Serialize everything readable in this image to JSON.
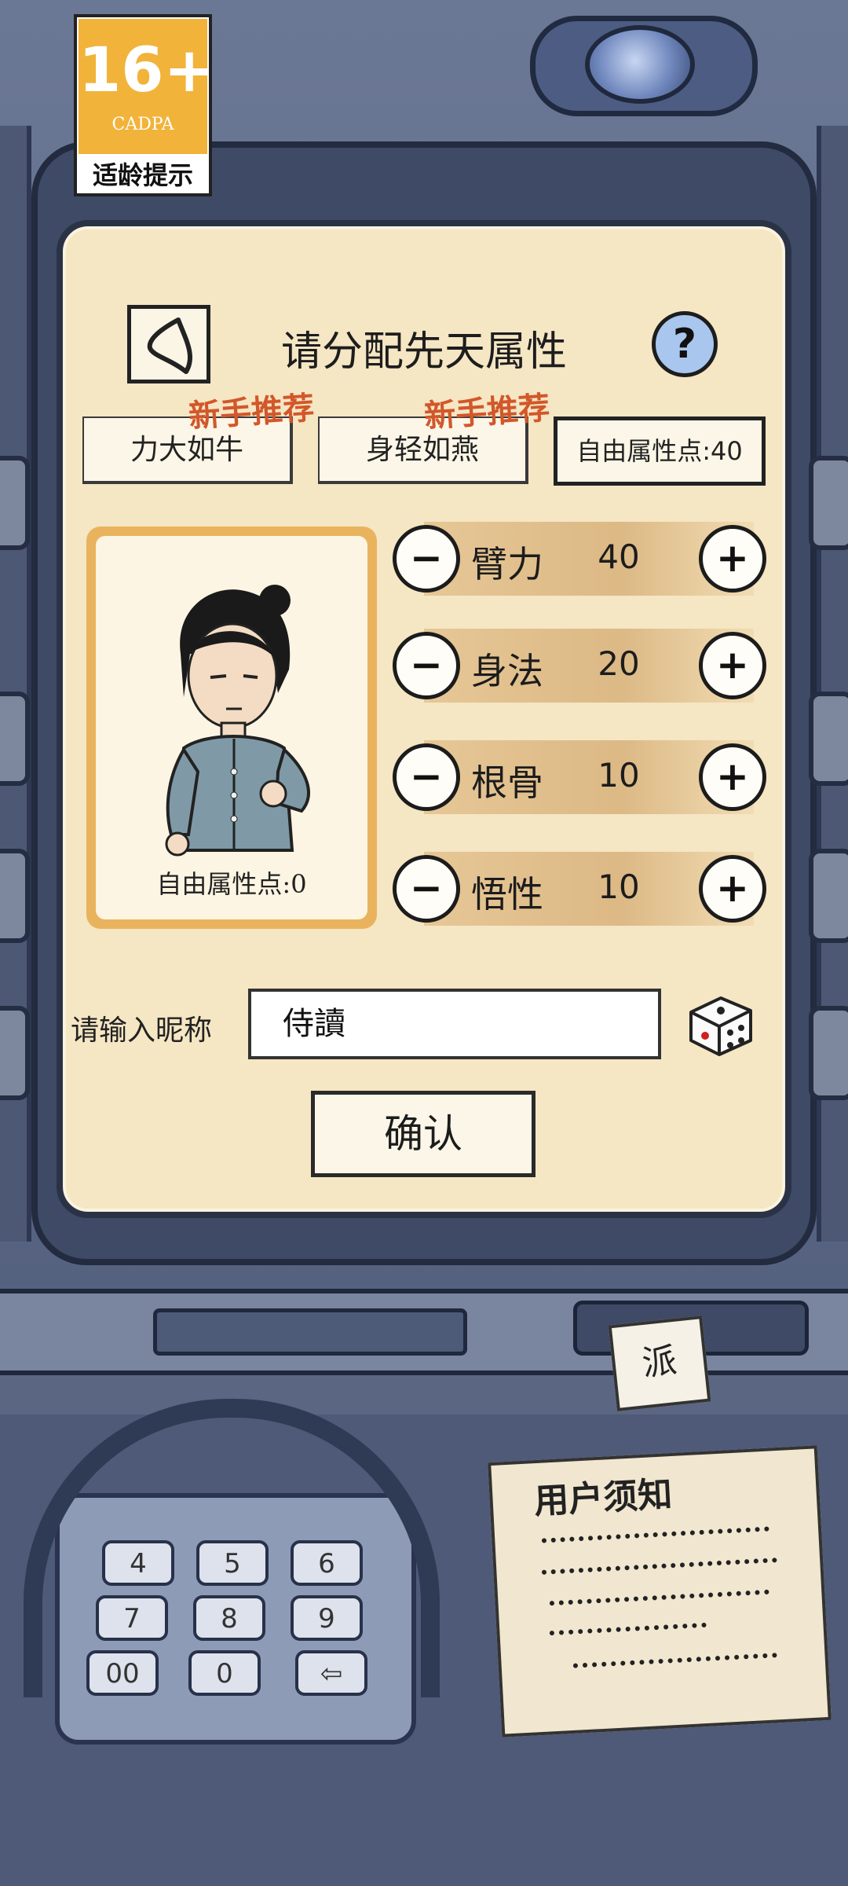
{
  "age_rating": {
    "number": "16+",
    "org": "CADPA",
    "tip": "适龄提示"
  },
  "dialog": {
    "title": "请分配先天属性",
    "help_label": "?",
    "presets": [
      {
        "label": "力大如牛",
        "tag": "新手推荐"
      },
      {
        "label": "身轻如燕",
        "tag": "新手推荐"
      }
    ],
    "free_points_label": "自由属性点:40",
    "portrait_caption": "自由属性点:0",
    "attributes": [
      {
        "name": "臂力",
        "value": "40"
      },
      {
        "name": "身法",
        "value": "20"
      },
      {
        "name": "根骨",
        "value": "10"
      },
      {
        "name": "悟性",
        "value": "10"
      }
    ],
    "minus_label": "−",
    "plus_label": "+",
    "nickname_label": "请输入昵称",
    "nickname_value": "侍讀",
    "confirm_label": "确认"
  },
  "atm": {
    "card_text": "派",
    "notice_title": "用户须知",
    "keys": [
      "4",
      "5",
      "6",
      "7",
      "8",
      "9",
      "00",
      "0",
      "⇦"
    ]
  }
}
